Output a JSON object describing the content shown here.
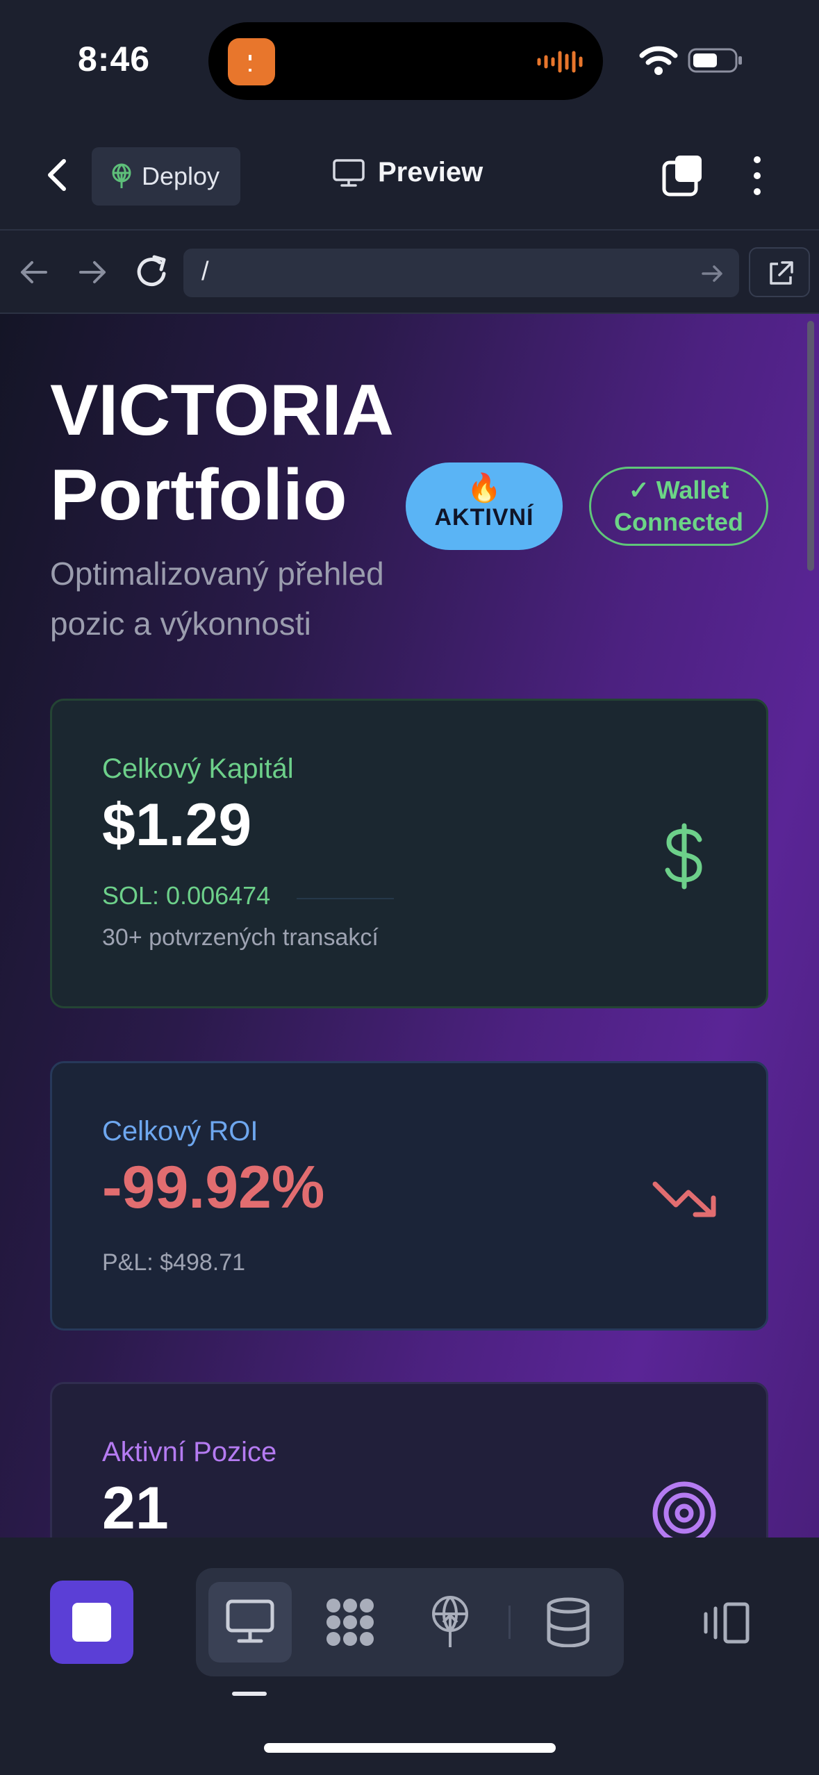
{
  "status_bar": {
    "time": "8:46"
  },
  "header": {
    "deploy_label": "Deploy",
    "preview_label": "Preview"
  },
  "url_bar": {
    "value": "/"
  },
  "page": {
    "title_line1": "VICTORIA",
    "title_line2": "Portfolio",
    "badge_active_emoji": "🔥",
    "badge_active": "AKTIVNÍ",
    "badge_wallet_line1": "✓ Wallet",
    "badge_wallet_line2": "Connected",
    "subtitle": "Optimalizovaný přehled pozic a výkonnosti"
  },
  "cards": [
    {
      "label": "Celkový Kapitál",
      "value": "$1.29",
      "sub": "SOL: 0.006474",
      "note": "30+ potvrzených transakcí",
      "icon": "dollar-icon",
      "accent": "#6dd08a"
    },
    {
      "label": "Celkový ROI",
      "value": "-99.92%",
      "note": "P&L: $498.71",
      "icon": "trending-down-icon",
      "accent": "#e26d70"
    },
    {
      "label": "Aktivní Pozice",
      "value": "21",
      "icon": "target-icon",
      "accent": "#b57bf2"
    }
  ],
  "toolbar": {
    "icons": [
      "stop-icon",
      "desktop-icon",
      "grid-icon",
      "deploy-icon",
      "database-icon",
      "layout-icon"
    ]
  }
}
